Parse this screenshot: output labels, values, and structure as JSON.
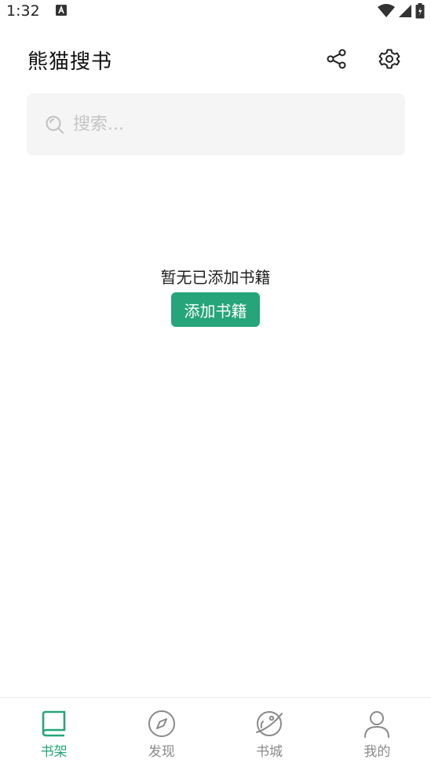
{
  "status_bar": {
    "time": "1:32",
    "icons": [
      "a-notification-icon",
      "wifi-icon",
      "signal-icon",
      "battery-icon"
    ]
  },
  "header": {
    "title": "熊猫搜书",
    "actions": [
      "share-icon",
      "settings-icon"
    ]
  },
  "search": {
    "placeholder": "搜索..."
  },
  "empty_state": {
    "message": "暂无已添加书籍",
    "button_label": "添加书籍"
  },
  "bottom_nav": {
    "items": [
      {
        "label": "书架",
        "icon": "bookshelf-icon",
        "active": true
      },
      {
        "label": "发现",
        "icon": "compass-icon",
        "active": false
      },
      {
        "label": "书城",
        "icon": "planet-icon",
        "active": false
      },
      {
        "label": "我的",
        "icon": "person-icon",
        "active": false
      }
    ]
  },
  "colors": {
    "accent": "#26a57b",
    "inactive": "#8a8a8a",
    "search_bg": "#f5f5f5"
  }
}
